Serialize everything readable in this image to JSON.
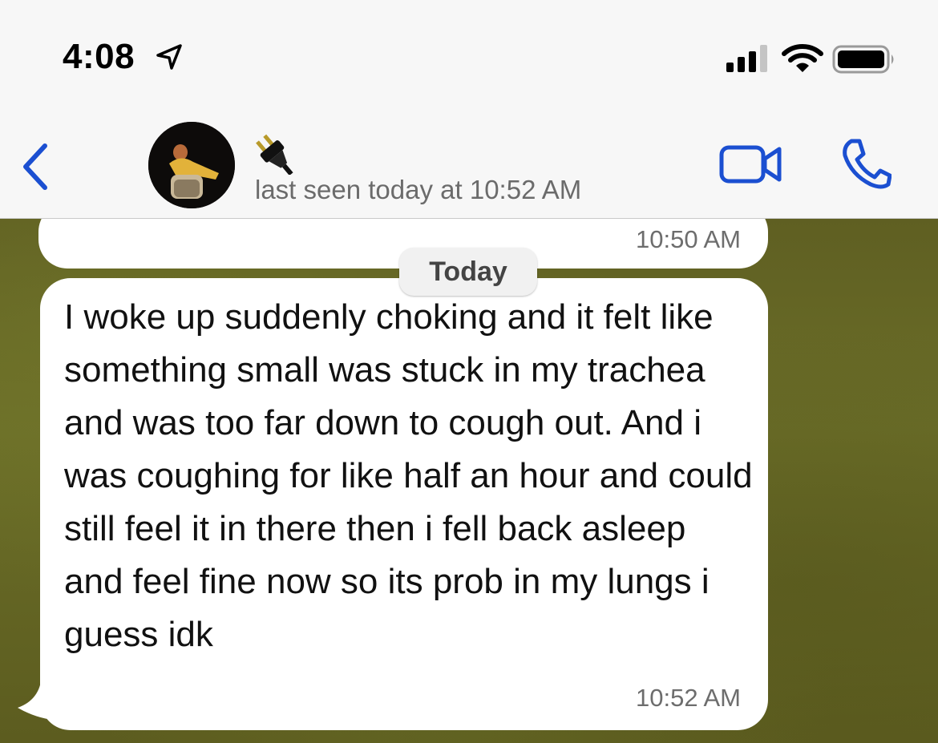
{
  "status_bar": {
    "time": "4:08",
    "location_icon": "location-arrow-icon",
    "signal_icon": "cellular-signal-icon",
    "wifi_icon": "wifi-icon",
    "battery_icon": "battery-icon"
  },
  "header": {
    "back_icon": "chevron-left-icon",
    "contact_name_icon": "electric-plug-icon",
    "last_seen": "last seen today at 10:52 AM",
    "video_icon": "video-camera-icon",
    "call_icon": "phone-icon",
    "accent_color": "#1b4fd1"
  },
  "chat": {
    "previous_message_time": "10:50 AM",
    "date_separator": "Today",
    "message": {
      "text": "I woke up suddenly choking and it felt like something small was stuck in my trachea and was too far down to cough out. And i was coughing for like half an hour and could still feel it in there then i fell back asleep and feel fine now so its prob in my lungs i guess idk",
      "time": "10:52 AM"
    }
  }
}
